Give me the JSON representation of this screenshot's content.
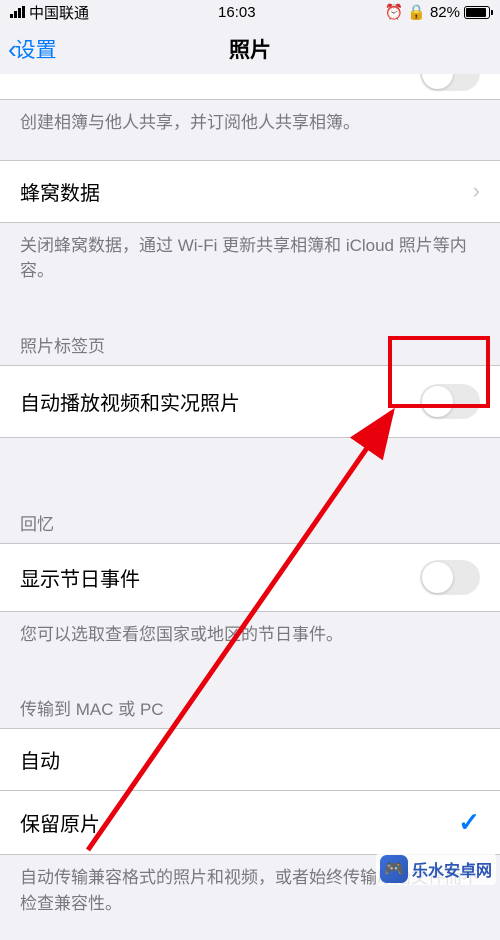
{
  "statusbar": {
    "carrier": "中国联通",
    "time": "16:03",
    "battery_pct": "82%"
  },
  "nav": {
    "back_label": "设置",
    "title": "照片"
  },
  "sections": {
    "shared_footer": "创建相簿与他人共享，并订阅他人共享相簿。",
    "cellular_label": "蜂窝数据",
    "cellular_footer": "关闭蜂窝数据，通过 Wi-Fi 更新共享相簿和 iCloud 照片等内容。",
    "tabs_header": "照片标签页",
    "autoplay_label": "自动播放视频和实况照片",
    "memories_header": "回忆",
    "holiday_label": "显示节日事件",
    "holiday_footer": "您可以选取查看您国家或地区的节日事件。",
    "transfer_header": "传输到 MAC 或 PC",
    "transfer_auto": "自动",
    "transfer_keep": "保留原片",
    "transfer_footer": "自动传输兼容格式的照片和视频，或者始终传输原始文件而不检查兼容性。"
  },
  "watermark": {
    "text": "乐水安卓网"
  },
  "toggle_states": {
    "autoplay": false,
    "holiday": false
  }
}
